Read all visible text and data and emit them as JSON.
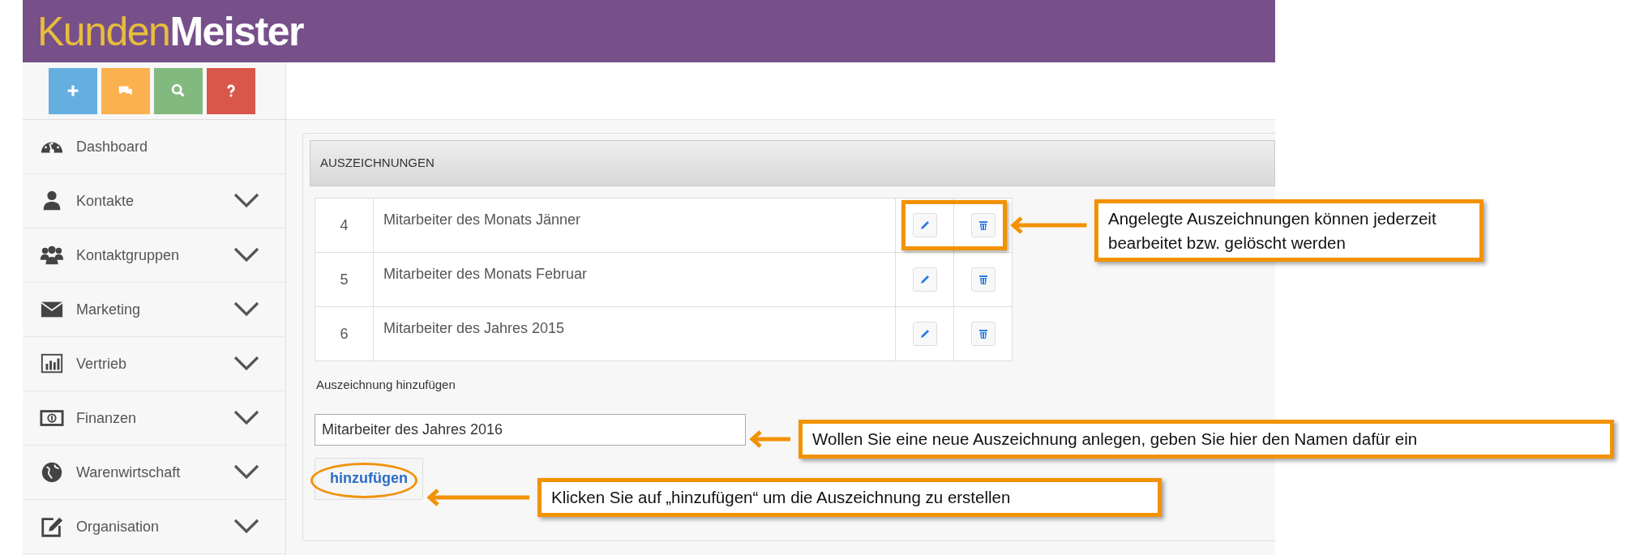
{
  "header": {
    "logo": [
      "Kunden",
      "Meister"
    ]
  },
  "quick_buttons": [
    {
      "kind": "add",
      "color": "#65aee0"
    },
    {
      "kind": "chat",
      "color": "#fbb14e"
    },
    {
      "kind": "search",
      "color": "#82b97f"
    },
    {
      "kind": "help",
      "color": "#d9574a"
    }
  ],
  "sidebar": {
    "items": [
      {
        "label": "Dashboard",
        "kind": "gauge",
        "expandable": false
      },
      {
        "label": "Kontakte",
        "kind": "user",
        "expandable": true
      },
      {
        "label": "Kontaktgruppen",
        "kind": "users",
        "expandable": true
      },
      {
        "label": "Marketing",
        "kind": "envelope",
        "expandable": true
      },
      {
        "label": "Vertrieb",
        "kind": "chart",
        "expandable": true
      },
      {
        "label": "Finanzen",
        "kind": "money",
        "expandable": true
      },
      {
        "label": "Warenwirtschaft",
        "kind": "globe",
        "expandable": true
      },
      {
        "label": "Organisation",
        "kind": "edit",
        "expandable": true
      }
    ]
  },
  "panel": {
    "title": "AUSZEICHNUNGEN",
    "rows": [
      {
        "number": "4",
        "name": "Mitarbeiter des Monats Jänner",
        "highlighted": true
      },
      {
        "number": "5",
        "name": "Mitarbeiter des Monats Februar",
        "highlighted": false
      },
      {
        "number": "6",
        "name": "Mitarbeiter des Jahres 2015",
        "highlighted": false
      }
    ],
    "add_label": "Auszeichnung hinzufügen",
    "input_value": "Mitarbeiter des Jahres 2016",
    "add_button": {
      "label": "hinzufügen",
      "circled": true
    }
  },
  "callouts": [
    {
      "kind": "row_actions",
      "text": "Angelegte Auszeichnungen können jederzeit bearbeitet bzw. gelöscht werden"
    },
    {
      "kind": "input",
      "text": "Wollen Sie eine neue Auszeichnung anlegen, geben Sie hier den Namen dafür ein"
    },
    {
      "kind": "button",
      "text": "Klicken Sie auf „hinzufügen“ um die Auszeichnung zu erstellen"
    }
  ]
}
